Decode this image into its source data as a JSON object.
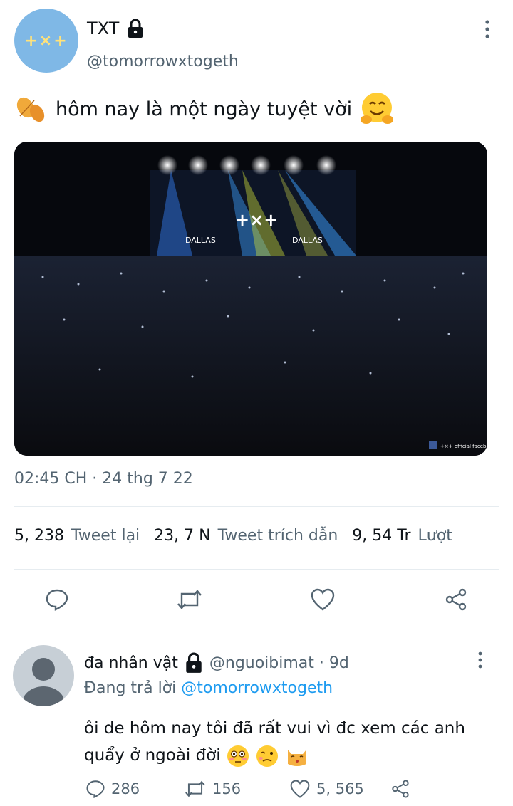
{
  "tweet": {
    "avatar_text": "+×+",
    "display_name": "TXT",
    "handle": "@tomorrowxtogeth",
    "text": "hôm nay là một ngày tuyệt vời",
    "timestamp": "02:45 CH · 24 thg 7 22",
    "media_texts": {
      "stage_logo": "+×+",
      "screen_left": "DALLAS",
      "screen_right": "DALLAS",
      "watermark": "+×+ official facebook"
    },
    "stats": {
      "retweets_count": "5, 238",
      "retweets_label": "Tweet lại",
      "quotes_count": "23, 7 N",
      "quotes_label": "Tweet trích dẫn",
      "likes_count": "9, 54 Tr",
      "likes_label": "Lượt"
    }
  },
  "reply": {
    "display_name": "đa nhân vật",
    "handle_time": "@nguoibimat · 9d",
    "replying_prefix": "Đang trả lời",
    "replying_to": "@tomorrowxtogeth",
    "text": "ôi de hôm nay tôi đã rất vui vì đc xem các anh quẩy ở ngoài đời",
    "reply_count": "286",
    "retweet_count": "156",
    "like_count": "5, 565"
  },
  "colors": {
    "accent": "#1d9bf0",
    "muted": "#536471",
    "text": "#0f1419"
  },
  "icons": [
    "lock-icon",
    "more-icon",
    "leaf-icon",
    "hug-emoji-icon",
    "reply-icon",
    "retweet-icon",
    "like-icon",
    "share-icon",
    "flushed-emoji-icon",
    "woozy-emoji-icon",
    "kissing-cat-emoji-icon"
  ]
}
